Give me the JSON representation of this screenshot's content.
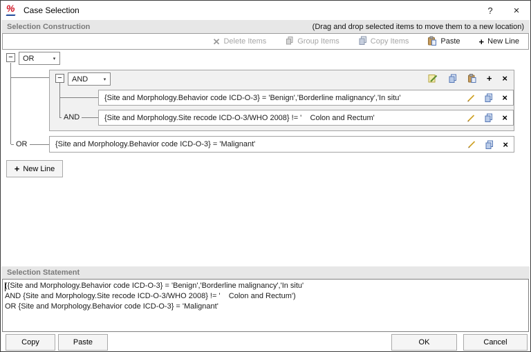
{
  "window": {
    "title": "Case Selection",
    "help_glyph": "?",
    "close_glyph": "×"
  },
  "glyphs": {
    "minus": "−",
    "dropdown": "▾",
    "plus": "+",
    "x": "×"
  },
  "construction": {
    "header": "Selection Construction",
    "hint": "(Drag and drop selected items to move them to a new location)",
    "toolbar": {
      "delete": "Delete Items",
      "group": "Group Items",
      "copy": "Copy Items",
      "paste": "Paste",
      "new_line": "New Line"
    },
    "root_operator": "OR",
    "group_operator": "AND",
    "branch_and": "AND",
    "branch_or": "OR",
    "conditions": [
      "{Site and Morphology.Behavior code ICD-O-3} = 'Benign','Borderline malignancy','In situ'",
      "{Site and Morphology.Site recode ICD-O-3/WHO 2008} != '    Colon and Rectum'",
      "{Site and Morphology.Behavior code ICD-O-3} = 'Malignant'"
    ],
    "new_line_button": "New Line"
  },
  "statement": {
    "header": "Selection Statement",
    "lines": [
      "({Site and Morphology.Behavior code ICD-O-3} = 'Benign','Borderline malignancy','In situ'",
      "AND {Site and Morphology.Site recode ICD-O-3/WHO 2008} != '    Colon and Rectum')",
      "OR {Site and Morphology.Behavior code ICD-O-3} = 'Malignant'"
    ]
  },
  "footer": {
    "copy": "Copy",
    "paste": "Paste",
    "ok": "OK",
    "cancel": "Cancel"
  },
  "colors": {
    "header_bg": "#e7e7e7",
    "header_text": "#7a7a7a",
    "border": "#a3a3a3",
    "group_bg": "#f1f1f1",
    "disabled_text": "#a6a6a6",
    "icon_red": "#cf1020",
    "icon_blue": "#234a9a"
  }
}
